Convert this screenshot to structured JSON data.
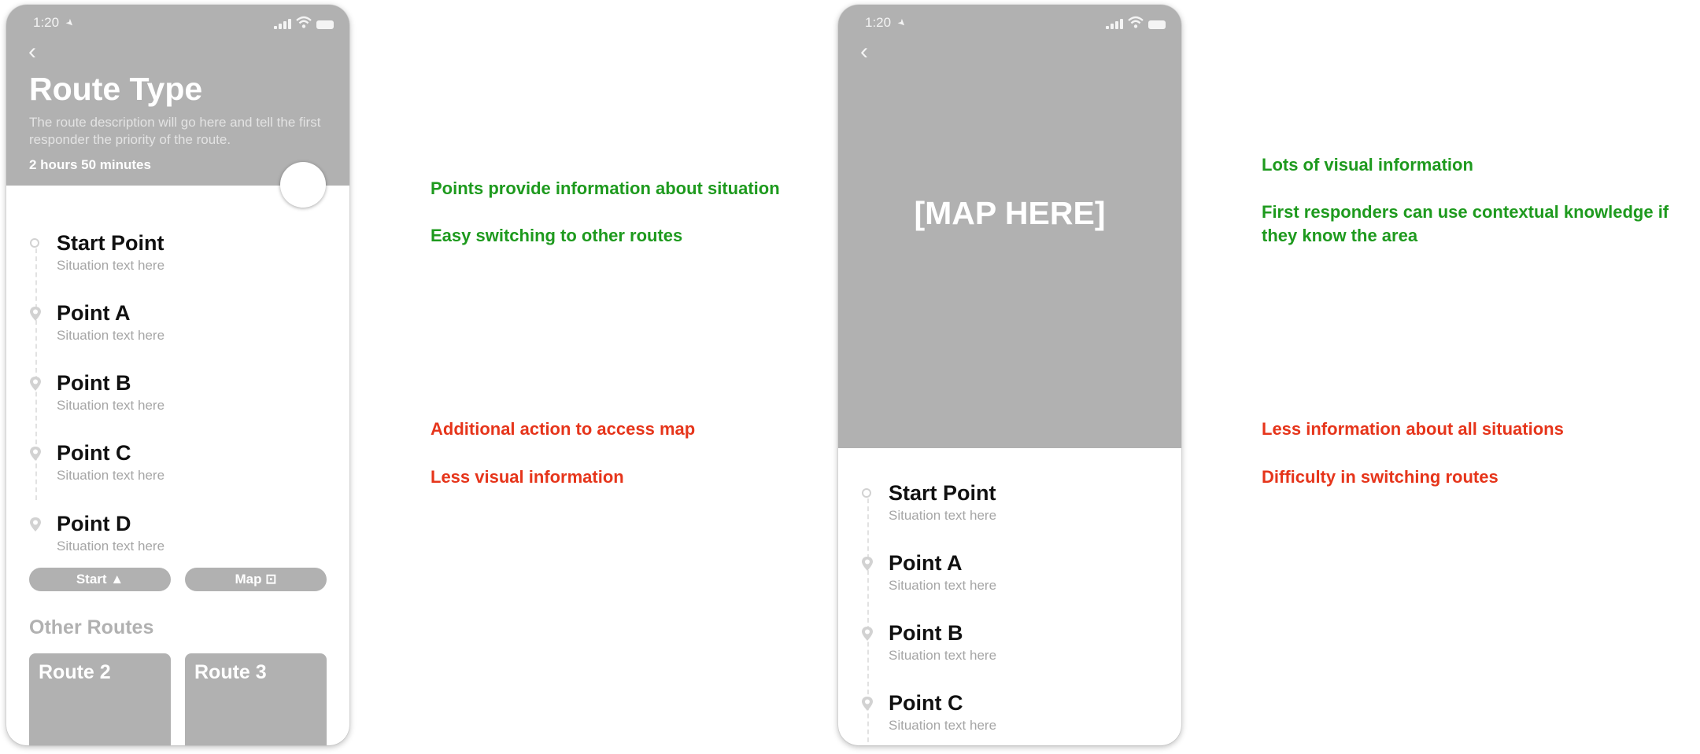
{
  "colors": {
    "placeholder_gray": "#b1b1b1",
    "pro_green": "#1e9a1e",
    "con_red": "#e6351b"
  },
  "phone1": {
    "status_time": "1:20",
    "title": "Route Type",
    "description": "The route description will go here and tell the first responder the priority of the route.",
    "duration": "2 hours 50 minutes",
    "points": [
      {
        "name": "Start Point",
        "situation": "Situation text here",
        "marker": "circle"
      },
      {
        "name": "Point A",
        "situation": "Situation text here",
        "marker": "pin"
      },
      {
        "name": "Point B",
        "situation": "Situation text here",
        "marker": "pin"
      },
      {
        "name": "Point C",
        "situation": "Situation text here",
        "marker": "pin"
      },
      {
        "name": "Point D",
        "situation": "Situation text here",
        "marker": "pin"
      }
    ],
    "start_button": "Start",
    "map_button": "Map",
    "other_routes_heading": "Other Routes",
    "other_routes": [
      "Route 2",
      "Route 3"
    ]
  },
  "phone2": {
    "status_time": "1:20",
    "map_placeholder": "[MAP HERE]",
    "points": [
      {
        "name": "Start Point",
        "situation": "Situation text here",
        "marker": "circle"
      },
      {
        "name": "Point A",
        "situation": "Situation text here",
        "marker": "pin"
      },
      {
        "name": "Point B",
        "situation": "Situation text here",
        "marker": "pin"
      },
      {
        "name": "Point C",
        "situation": "Situation text here",
        "marker": "pin"
      }
    ]
  },
  "notes_left": {
    "pros": [
      "Points provide information about situation",
      "Easy switching to other routes"
    ],
    "cons": [
      "Additional action to access map",
      "Less visual information"
    ]
  },
  "notes_right": {
    "pros": [
      "Lots of visual information",
      "First responders can use contextual knowledge if they know the area"
    ],
    "cons": [
      "Less information about all situations",
      "Difficulty in switching routes"
    ]
  }
}
